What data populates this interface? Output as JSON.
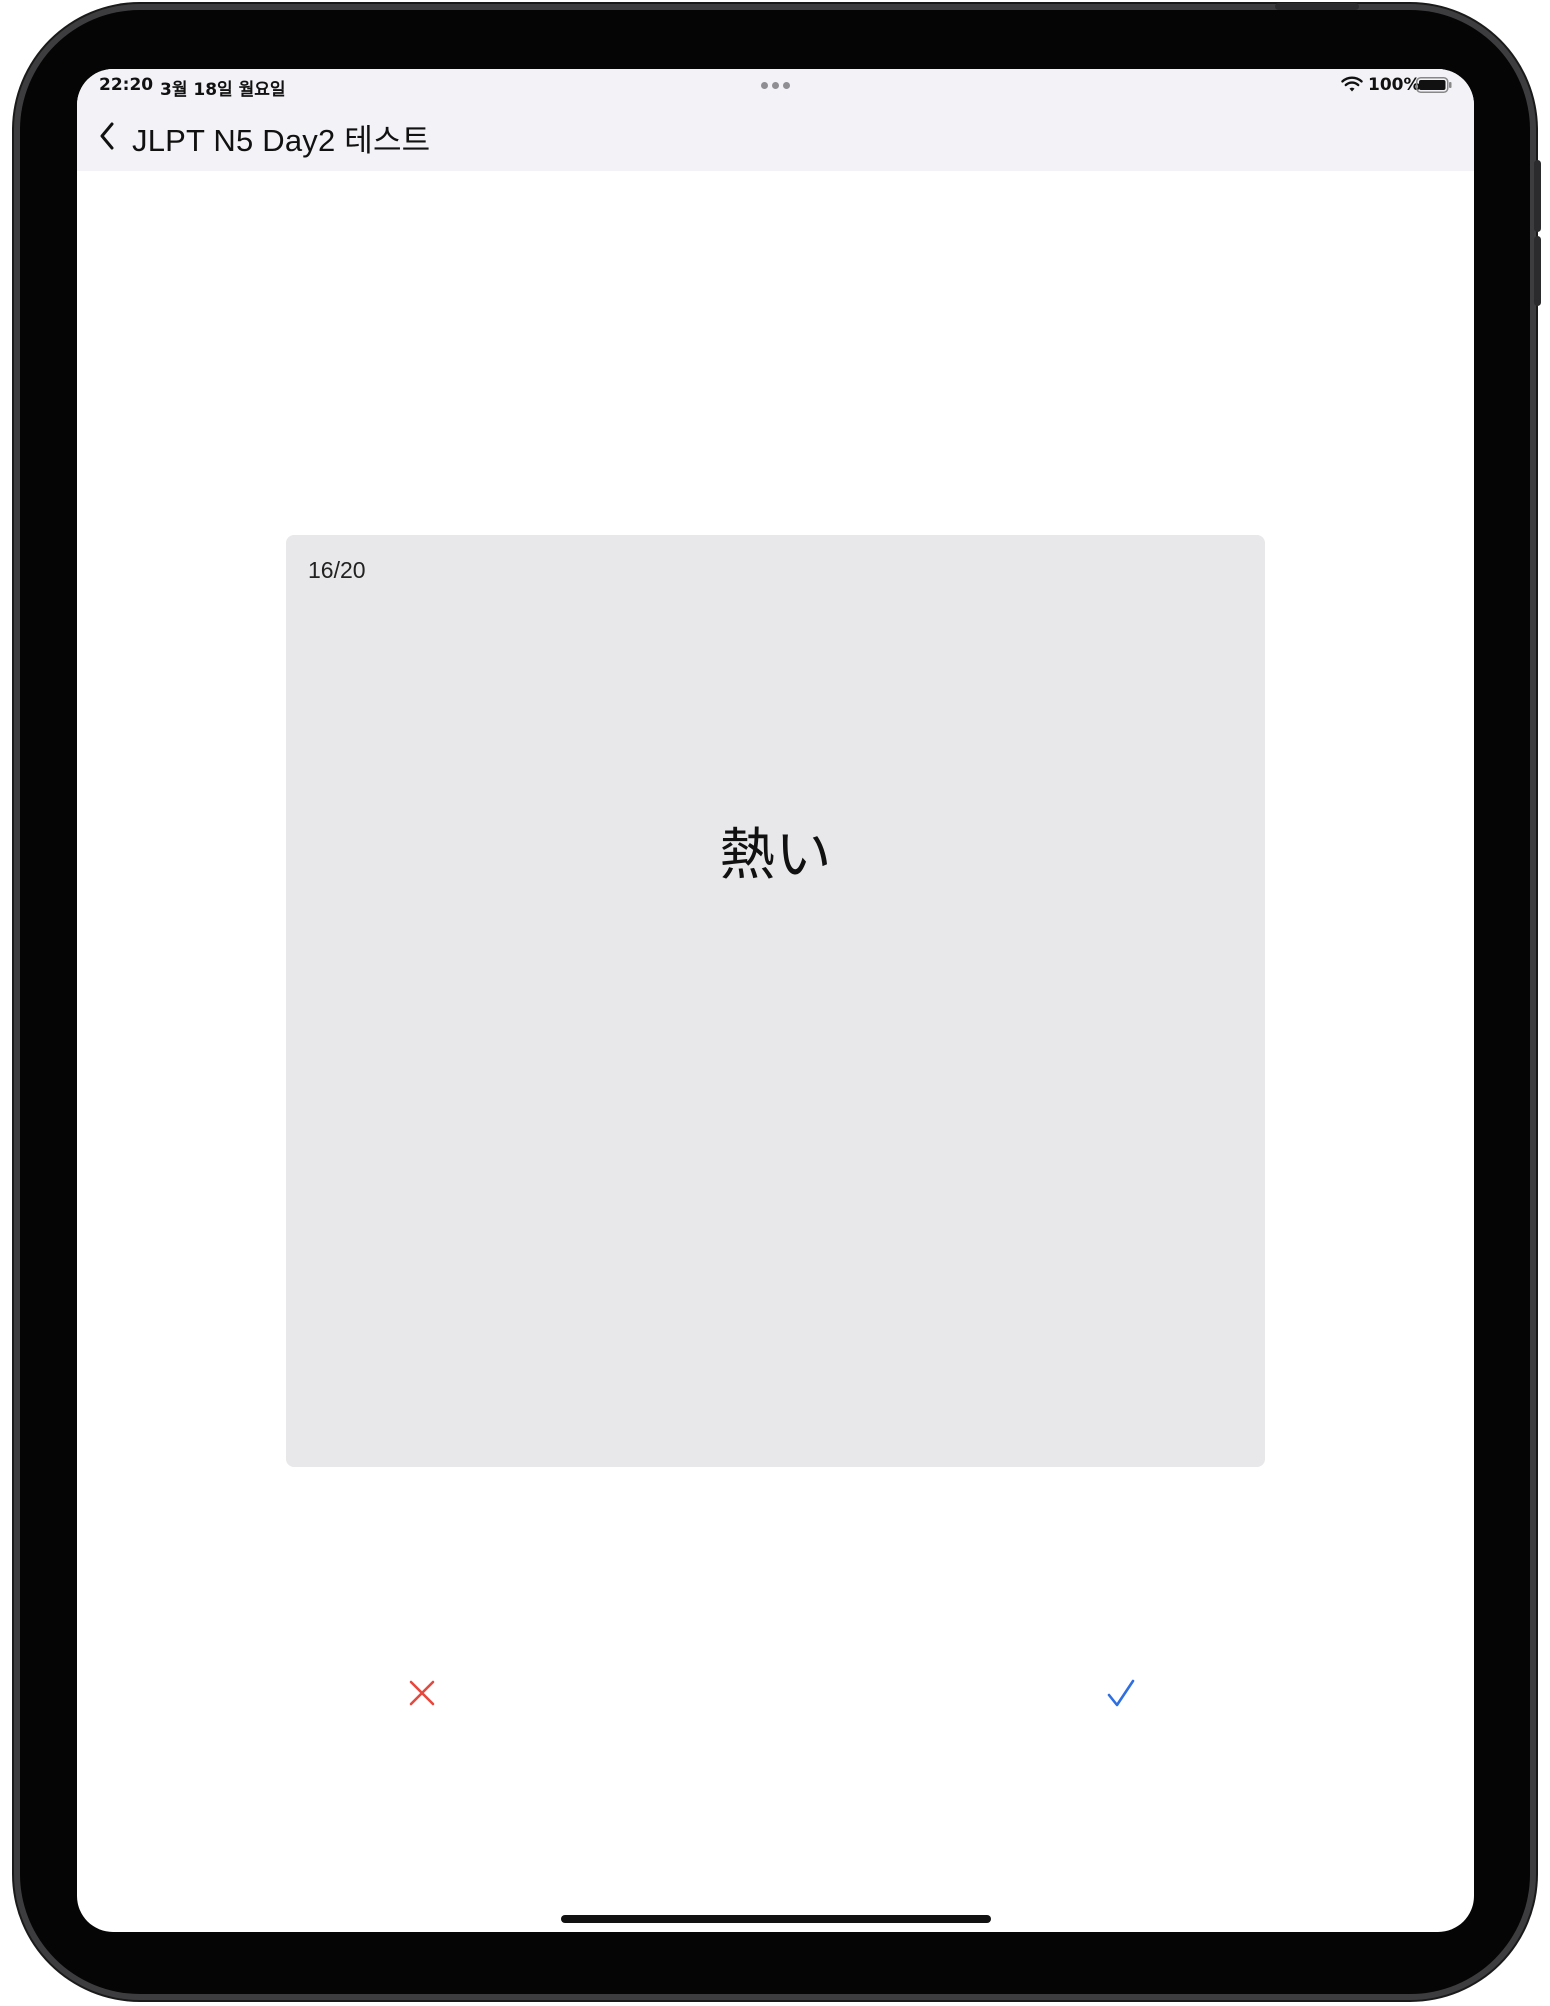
{
  "status_bar": {
    "time": "22:20",
    "date": "3월 18일 월요일",
    "battery": "100%",
    "icons": [
      "wifi-icon",
      "battery-icon",
      "multitask-dots-icon"
    ]
  },
  "nav": {
    "back_icon": "chevron-left-icon",
    "title": "JLPT N5 Day2 테스트"
  },
  "card": {
    "progress": "16/20",
    "word": "熱い"
  },
  "actions": {
    "wrong_icon": "x-mark-icon",
    "correct_icon": "checkmark-icon"
  },
  "colors": {
    "background": "#ffffff",
    "nav_background": "#f2f2f7",
    "card_background": "#e8e8ea",
    "wrong": "#e5483e",
    "correct": "#2f6fe0",
    "text": "#111111"
  }
}
